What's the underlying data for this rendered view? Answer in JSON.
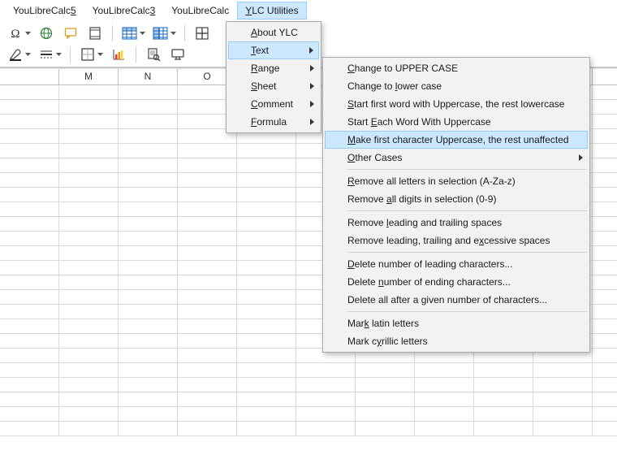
{
  "menubar": {
    "items": [
      {
        "label": "YouLibreCalc5",
        "accel_index": 12
      },
      {
        "label": "YouLibreCalc3",
        "accel_index": 12
      },
      {
        "label": "YouLibreCalc"
      },
      {
        "label": "YLC Utilities",
        "accel_index": 0,
        "open": true
      }
    ]
  },
  "ylc_menu": {
    "items": [
      {
        "label": "About YLC",
        "accel_index": 0
      },
      {
        "label": "Text",
        "accel_index": 0,
        "submenu": true,
        "highlight": true
      },
      {
        "label": "Range",
        "accel_index": 0,
        "submenu": true
      },
      {
        "label": "Sheet",
        "accel_index": 0,
        "submenu": true
      },
      {
        "label": "Comment",
        "accel_index": 0,
        "submenu": true
      },
      {
        "label": "Formula",
        "accel_index": 0,
        "submenu": true
      }
    ]
  },
  "text_submenu": {
    "groups": [
      [
        {
          "label": "Change to UPPER CASE",
          "accel_index": 0
        },
        {
          "label": "Change to lower case",
          "accel_index": 10
        },
        {
          "label": "Start first word with Uppercase, the rest lowercase",
          "accel_index": 0
        },
        {
          "label": "Start Each Word With Uppercase",
          "accel_index": 6
        },
        {
          "label": "Make first character Uppercase, the rest unaffected",
          "accel_index": 0,
          "highlight": true
        },
        {
          "label": "Other Cases",
          "accel_index": 0,
          "submenu": true
        }
      ],
      [
        {
          "label": "Remove all letters in selection (A-Za-z)",
          "accel_index": 0
        },
        {
          "label": "Remove all digits in selection (0-9)",
          "accel_index": 7
        }
      ],
      [
        {
          "label": "Remove leading and trailing spaces",
          "accel_index": 7
        },
        {
          "label": "Remove leading, trailing and excessive spaces",
          "accel_index": 30
        }
      ],
      [
        {
          "label": "Delete number of leading characters...",
          "accel_index": 0
        },
        {
          "label": "Delete number of ending characters...",
          "accel_index": 7
        },
        {
          "label": "Delete all after a given number of characters...",
          "accel_index": 19
        }
      ],
      [
        {
          "label": "Mark latin letters",
          "accel_index": 3
        },
        {
          "label": "Mark cyrillic letters",
          "accel_index": 6
        }
      ]
    ]
  },
  "columns": [
    "",
    "M",
    "N",
    "O",
    "",
    "",
    "",
    "",
    "",
    ""
  ],
  "colors": {
    "highlight_bg": "#cce8ff",
    "highlight_border": "#96cdf5",
    "menu_bg": "#f2f2f2",
    "menu_border": "#a9a9a9"
  }
}
